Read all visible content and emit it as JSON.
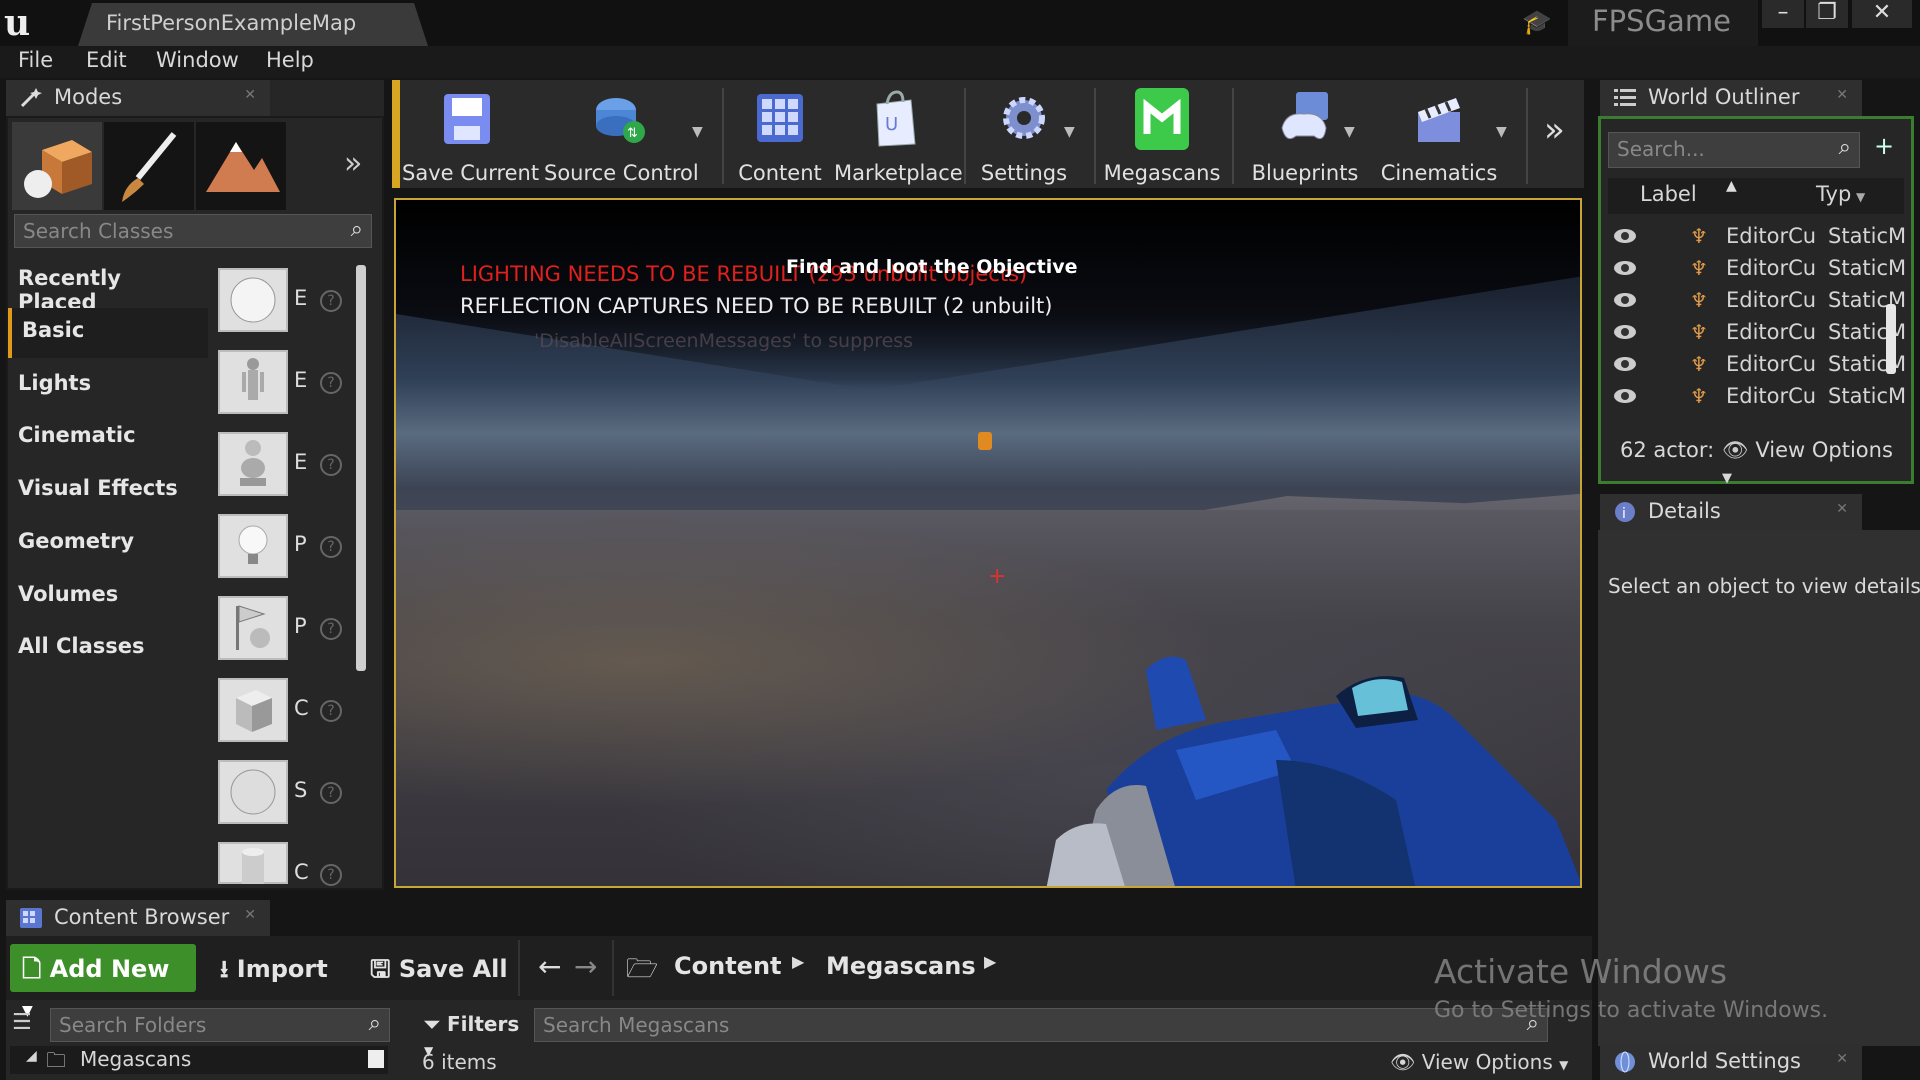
{
  "window": {
    "level_tab": "FirstPersonExampleMap",
    "project_name": "FPSGame",
    "min_icon": "minimize-icon",
    "restore_icon": "restore-icon",
    "close_icon": "close-icon"
  },
  "menu": [
    "File",
    "Edit",
    "Window",
    "Help"
  ],
  "modes": {
    "tab_label": "Modes",
    "search_placeholder": "Search Classes",
    "categories": [
      "Recently Placed",
      "Basic",
      "Lights",
      "Cinematic",
      "Visual Effects",
      "Geometry",
      "Volumes",
      "All Classes"
    ],
    "active_category": "Basic",
    "placeable_labels": [
      "E",
      "E",
      "E",
      "P",
      "P",
      "C",
      "S",
      "C"
    ]
  },
  "toolbar": {
    "items": [
      "Save Current",
      "Source Control",
      "Content",
      "Marketplace",
      "Settings",
      "Megascans",
      "Blueprints",
      "Cinematics"
    ]
  },
  "viewport": {
    "msg_lighting": "LIGHTING NEEDS TO BE REBUILT (293 unbuilt objects)",
    "msg_reflection": "REFLECTION CAPTURES NEED TO BE REBUILT (2 unbuilt)",
    "msg_disable": "'DisableAllScreenMessages' to suppress",
    "objective": "Find and loot the Objective",
    "crosshair": "+"
  },
  "outliner": {
    "tab_label": "World Outliner",
    "search_placeholder": "Search...",
    "col_label": "Label",
    "col_type": "Typ",
    "rows": [
      {
        "label": "EditorCu",
        "type": "StaticM"
      },
      {
        "label": "EditorCu",
        "type": "StaticM"
      },
      {
        "label": "EditorCu",
        "type": "StaticM"
      },
      {
        "label": "EditorCu",
        "type": "StaticM"
      },
      {
        "label": "EditorCu",
        "type": "StaticM"
      },
      {
        "label": "EditorCu",
        "type": "StaticM"
      }
    ],
    "actor_count": "62 actor:",
    "view_options": "View Options"
  },
  "details": {
    "tab_label": "Details",
    "empty_msg": "Select an object to view details."
  },
  "world_settings": {
    "tab_label": "World Settings"
  },
  "content_browser": {
    "tab_label": "Content Browser",
    "add_new": "Add New",
    "import": "Import",
    "save_all": "Save All",
    "breadcrumb": [
      "Content",
      "Megascans"
    ],
    "folder_search_placeholder": "Search Folders",
    "tree_root": "Megascans",
    "filters": "Filters",
    "asset_search_placeholder": "Search Megascans",
    "items_count": "6 items",
    "view_options": "View Options"
  },
  "watermark": {
    "title": "Activate Windows",
    "subtitle": "Go to Settings to activate Windows."
  },
  "colors": {
    "accent_orange": "#e09a1a",
    "add_new_green": "#3d8f2a",
    "viewport_border": "#c8a534",
    "lighting_warning": "#e0201c"
  }
}
